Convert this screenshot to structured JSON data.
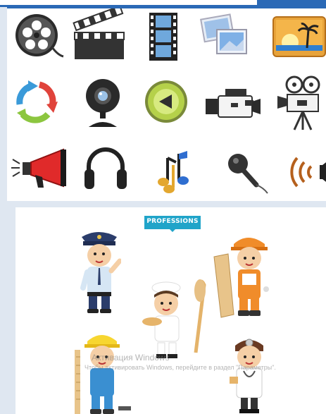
{
  "icons": [
    {
      "name": "film-reel-icon"
    },
    {
      "name": "clapperboard-icon"
    },
    {
      "name": "film-strip-icon"
    },
    {
      "name": "photos-icon"
    },
    {
      "name": "landscape-picture-icon"
    },
    {
      "name": "refresh-arrows-icon"
    },
    {
      "name": "webcam-icon"
    },
    {
      "name": "back-play-button-icon"
    },
    {
      "name": "video-camera-icon"
    },
    {
      "name": "movie-projector-camera-icon"
    },
    {
      "name": "megaphone-icon"
    },
    {
      "name": "headphones-icon"
    },
    {
      "name": "music-notes-icon"
    },
    {
      "name": "microphone-icon"
    },
    {
      "name": "speaker-sound-icon"
    }
  ],
  "professions": {
    "banner_label": "PROFESSIONS",
    "banner_color": "#20a4c9",
    "people": [
      {
        "name": "policeman"
      },
      {
        "name": "baker"
      },
      {
        "name": "construction-worker"
      },
      {
        "name": "builder-helmet"
      },
      {
        "name": "doctor"
      }
    ]
  },
  "watermark": {
    "line1": "Активация Windows",
    "line2": "Чтобы активировать Windows, перейдите в раздел \"Параметры\"."
  }
}
